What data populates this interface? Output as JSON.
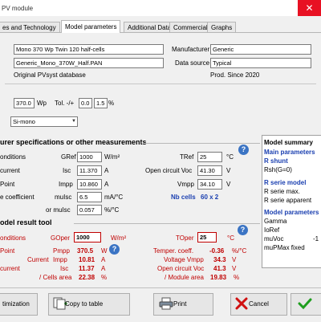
{
  "window": {
    "title": "PV module",
    "close_glyph": "✕"
  },
  "tabs": [
    {
      "label": "es and Technology"
    },
    {
      "label": "Model parameters"
    },
    {
      "label": "Additional Data"
    },
    {
      "label": "Commercial"
    },
    {
      "label": "Graphs"
    }
  ],
  "identification": {
    "model_name": "Mono 370 Wp Twin 120 half-cells",
    "file_name": "Generic_Mono_370W_Half.PAN",
    "source_note": "Original PVsyst database",
    "manufacturer_label": "Manufacturer",
    "manufacturer_value": "Generic",
    "datasource_label": "Data source",
    "datasource_value": "Typical",
    "prod_since": "Prod. Since 2020"
  },
  "power": {
    "value": "370.0",
    "unit": "Wp",
    "tol_label": "Tol. -/+",
    "tol_minus": "0.0",
    "tol_plus": "1.5",
    "tol_unit": "%",
    "technology": "Si-mono"
  },
  "specs": {
    "heading": "urer specifications or other measurements",
    "conditions_label": "onditions",
    "gref_label": "GRef",
    "gref_value": "1000",
    "gref_unit": "W/m²",
    "tref_label": "TRef",
    "tref_value": "25",
    "tref_unit": "°C",
    "current_label": "current",
    "isc_label": "Isc",
    "isc_value": "11.370",
    "isc_unit": "A",
    "voc_label": "Open circuit Voc",
    "voc_value": "41.30",
    "voc_unit": "V",
    "point_label": "Point",
    "impp_label": "Impp",
    "impp_value": "10.860",
    "impp_unit": "A",
    "vmpp_label": "Vmpp",
    "vmpp_value": "34.10",
    "vmpp_unit": "V",
    "coeff_label": "e coefficient",
    "muisc_label": "muIsc",
    "muisc_value": "6.5",
    "muisc_unit": "mA/°C",
    "or_label": "or muIsc",
    "or_value": "0.057",
    "or_unit": "%/°C",
    "nb_cells_label": "Nb cells",
    "nb_cells_value": "60 x 2"
  },
  "result": {
    "heading": "odel result tool",
    "conditions_label": "onditions",
    "goper_label": "GOper",
    "goper_value": "1000",
    "goper_unit": "W/m²",
    "toper_label": "TOper",
    "toper_value": "25",
    "toper_unit": "°C",
    "point_label": "Point",
    "pmpp_label": "Pmpp",
    "pmpp_value": "370.5",
    "pmpp_unit": "W",
    "tcoeff_label": "Temper. coeff.",
    "tcoeff_value": "-0.36",
    "tcoeff_unit": "%/°C",
    "current_label": "Current",
    "impp_label": "Impp",
    "impp_value": "10.81",
    "impp_unit": "A",
    "vmpp_label": "Voltage Vmpp",
    "vmpp_value": "34.3",
    "vmpp_unit": "V",
    "current2_label": "current",
    "isc_label": "Isc",
    "isc_value": "11.37",
    "isc_unit": "A",
    "voc_label": "Open circuit Voc",
    "voc_value": "41.3",
    "voc_unit": "V",
    "cells_area_label": "/ Cells area",
    "cells_area_value": "22.38",
    "cells_area_unit": "%",
    "module_area_label": "/ Module area",
    "module_area_value": "19.83",
    "module_area_unit": "%"
  },
  "summary": {
    "heading": "Model summary",
    "main_params": "Main parameters",
    "rshunt": "R shunt",
    "rsh0": "Rsh(G=0)",
    "rserie_model": "R serie model",
    "rserie_max": "R serie max.",
    "rserie_apparent": "R serie apparent",
    "model_params": "Model parameters",
    "gamma": "Gamma",
    "ioref": "IoRef",
    "muvoc": "muVoc",
    "muvoc_value": "-1",
    "mupmax": "muPMax fixed"
  },
  "buttons": {
    "optimization": "timization",
    "copy": "Copy to table",
    "print": "Print",
    "cancel": "Cancel"
  },
  "colors": {
    "accent_red": "#c00000",
    "accent_blue": "#1a3fb0",
    "help_blue": "#3b74c4",
    "close_red": "#e81123"
  }
}
